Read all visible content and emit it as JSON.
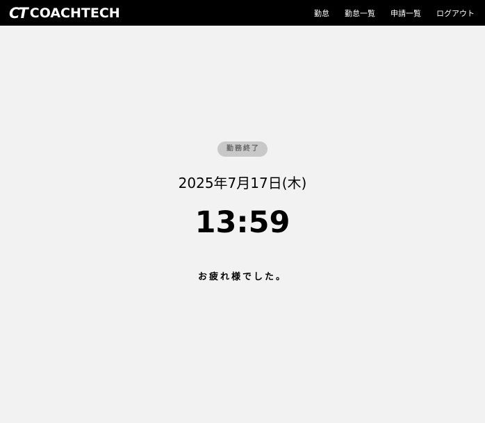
{
  "header": {
    "logo_mark": "CT",
    "logo_text": "COACHTECH",
    "nav": {
      "attendance": "勤怠",
      "attendance_list": "勤怠一覧",
      "request_list": "申請一覧",
      "logout": "ログアウト"
    }
  },
  "main": {
    "status_badge": "勤務終了",
    "date": "2025年7月17日(木)",
    "time": "13:59",
    "message": "お疲れ様でした。"
  },
  "colors": {
    "header_bg": "#000000",
    "page_bg": "#f2f2f2",
    "badge_bg": "#c8c8c8",
    "badge_text": "#696969"
  }
}
